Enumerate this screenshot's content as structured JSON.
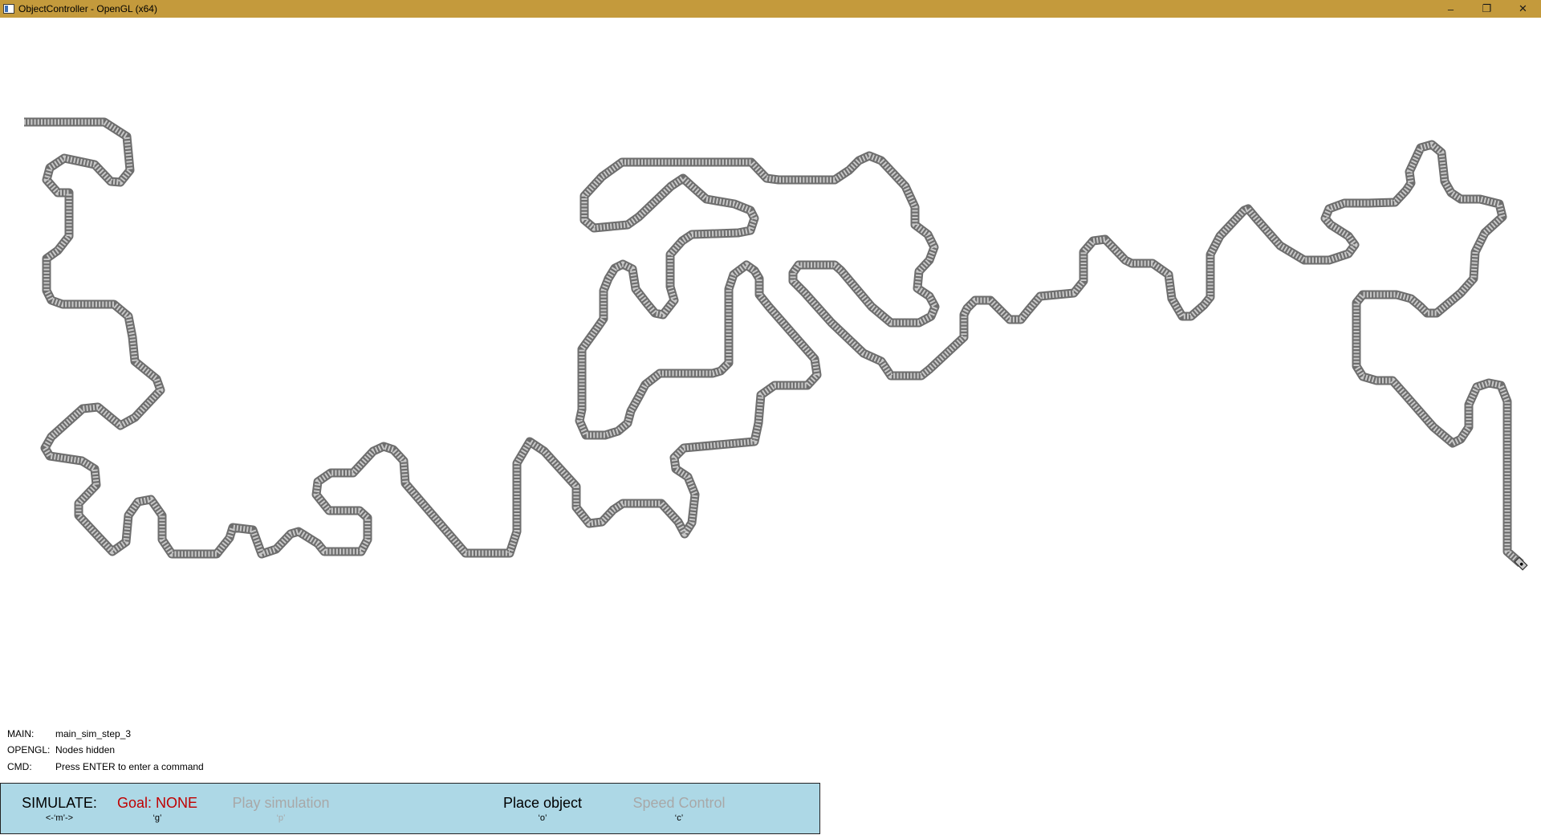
{
  "window": {
    "title": "ObjectController - OpenGL (x64)",
    "controls": [
      "–",
      "❐",
      "✕"
    ]
  },
  "status": [
    {
      "key": "MAIN:",
      "value": "main_sim_step_3"
    },
    {
      "key": "OPENGL:",
      "value": "Nodes hidden"
    },
    {
      "key": "CMD:",
      "value": "Press ENTER to enter a command"
    }
  ],
  "toolbar": {
    "simulate": {
      "label": "SIMULATE:",
      "key": "<-‘m’->"
    },
    "goal": {
      "label": "Goal: NONE",
      "key": "‘g’"
    },
    "play": {
      "label": "Play simulation",
      "key": "‘p’"
    },
    "place": {
      "label": "Place object",
      "key": "‘o’"
    },
    "speed": {
      "label": "Speed Control",
      "key": "‘c’"
    }
  },
  "colors": {
    "titlebar": "#c49a3c",
    "toolbar": "#add8e6",
    "track_fill": "#c8c8c8",
    "track_stroke": "#6e6e6e",
    "goal_red": "#c00000",
    "disabled_gray": "#a8a8a8"
  }
}
